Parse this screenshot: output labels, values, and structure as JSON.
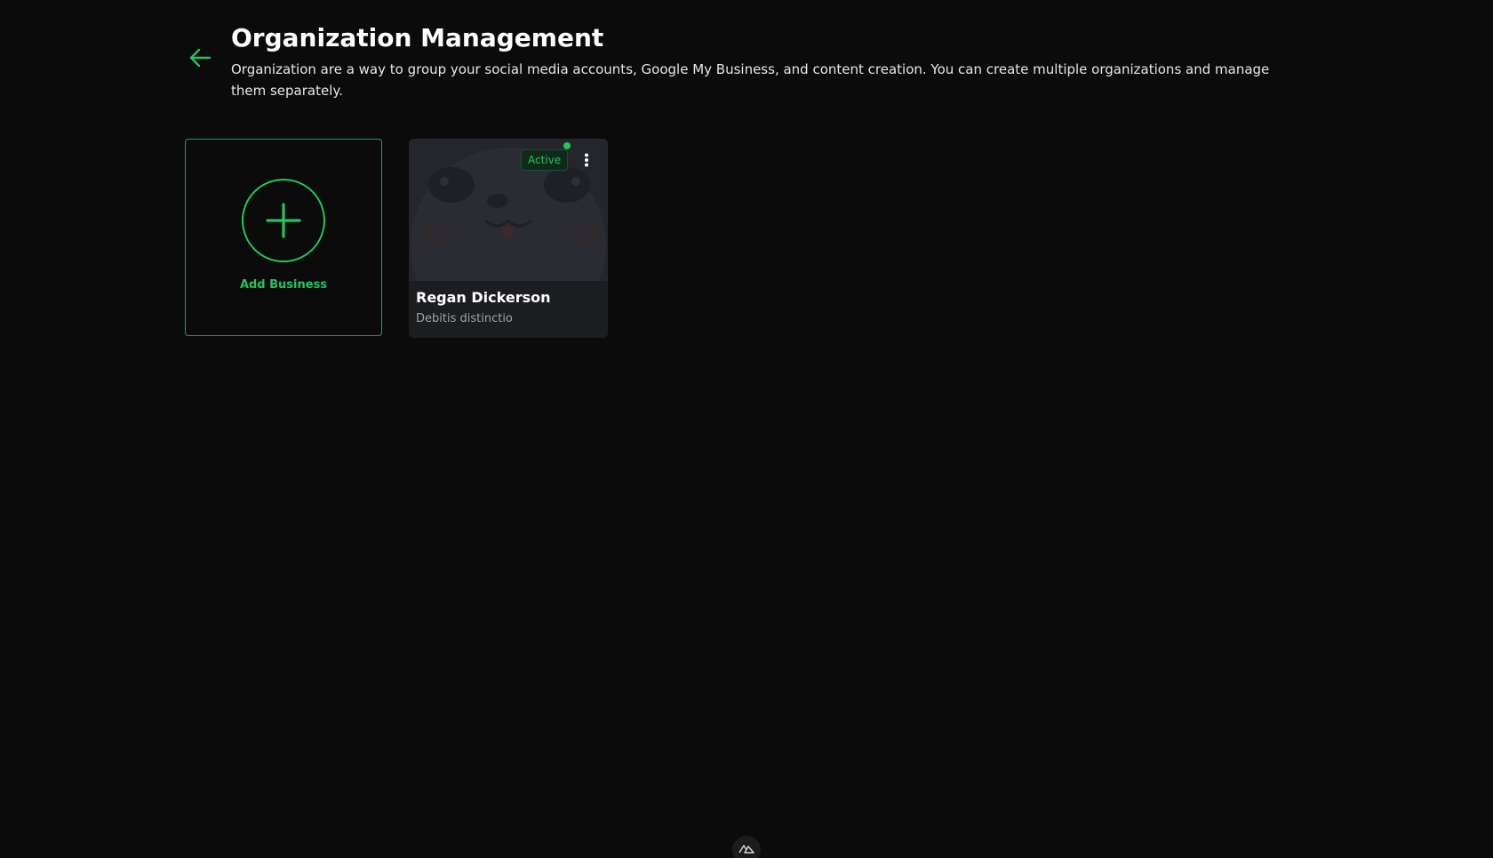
{
  "header": {
    "title": "Organization Management",
    "description": "Organization are a way to group your social media accounts, Google My Business, and content creation. You can create multiple organizations and manage them separately.",
    "back_icon": "arrow-left-icon"
  },
  "add_card": {
    "label": "Add Business",
    "icon": "plus-icon"
  },
  "organizations": [
    {
      "name": "Regan Dickerson",
      "subtitle": "Debitis distinctio",
      "status": "Active",
      "menu_icon": "more-vertical-icon"
    }
  ],
  "footer": {
    "icon": "nuxt-logo-icon"
  },
  "colors": {
    "background": "#0b0b0b",
    "accent": "#22c55e",
    "card": "#1c1d22",
    "muted_text": "#a1a1aa"
  }
}
